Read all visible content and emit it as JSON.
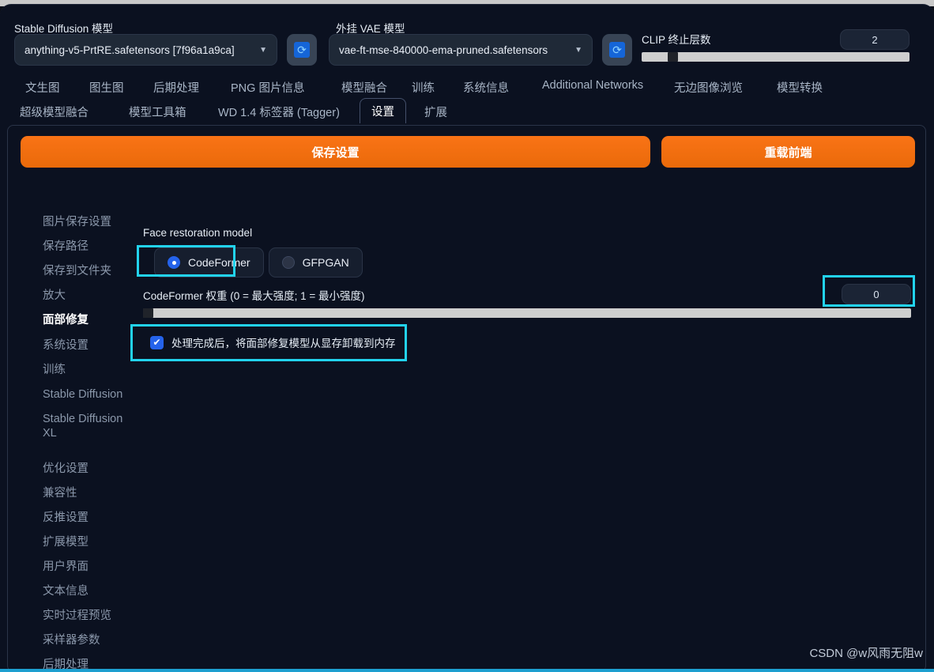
{
  "header": {
    "sd_model_label": "Stable Diffusion 模型",
    "sd_model_value": "anything-v5-PrtRE.safetensors [7f96a1a9ca]",
    "vae_label": "外挂 VAE 模型",
    "vae_value": "vae-ft-mse-840000-ema-pruned.safetensors",
    "clip_label": "CLIP 终止层数",
    "clip_value": "2",
    "refresh_icon": "refresh-icon",
    "caret_icon": "chevron-down-icon"
  },
  "tabs": {
    "row1": [
      {
        "label": "文生图",
        "active": false
      },
      {
        "label": "图生图",
        "active": false
      },
      {
        "label": "后期处理",
        "active": false
      },
      {
        "label": "PNG 图片信息",
        "active": false
      },
      {
        "label": "模型融合",
        "active": false
      },
      {
        "label": "训练",
        "active": false
      },
      {
        "label": "系统信息",
        "active": false
      },
      {
        "label": "Additional Networks",
        "active": false
      },
      {
        "label": "无边图像浏览",
        "active": false
      },
      {
        "label": "模型转换",
        "active": false
      }
    ],
    "row2": [
      {
        "label": "超级模型融合",
        "active": false
      },
      {
        "label": "模型工具箱",
        "active": false
      },
      {
        "label": "WD 1.4 标签器 (Tagger)",
        "active": false
      },
      {
        "label": "设置",
        "active": true
      },
      {
        "label": "扩展",
        "active": false
      }
    ]
  },
  "actions": {
    "save_label": "保存设置",
    "reload_label": "重载前端"
  },
  "sidebar": {
    "items": [
      {
        "label": "图片保存设置",
        "active": false
      },
      {
        "label": "保存路径",
        "active": false
      },
      {
        "label": "保存到文件夹",
        "active": false
      },
      {
        "label": "放大",
        "active": false
      },
      {
        "label": "面部修复",
        "active": true
      },
      {
        "label": "系统设置",
        "active": false
      },
      {
        "label": "训练",
        "active": false
      },
      {
        "label": "Stable Diffusion",
        "active": false
      },
      {
        "label": "Stable Diffusion XL",
        "active": false
      },
      {
        "label": "优化设置",
        "active": false
      },
      {
        "label": "兼容性",
        "active": false
      },
      {
        "label": "反推设置",
        "active": false
      },
      {
        "label": "扩展模型",
        "active": false
      },
      {
        "label": "用户界面",
        "active": false
      },
      {
        "label": "文本信息",
        "active": false
      },
      {
        "label": "实时过程预览",
        "active": false
      },
      {
        "label": "采样器参数",
        "active": false
      },
      {
        "label": "后期处理",
        "active": false
      }
    ]
  },
  "settings": {
    "face_restoration_model_label": "Face restoration model",
    "radios": [
      {
        "label": "CodeFormer",
        "checked": true
      },
      {
        "label": "GFPGAN",
        "checked": false
      }
    ],
    "codeformer_weight_label": "CodeFormer 权重 (0 = 最大强度; 1 = 最小强度)",
    "codeformer_weight_value": "0",
    "unload_checkbox_label": "处理完成后，将面部修复模型从显存卸载到内存",
    "unload_checkbox_checked": true
  },
  "watermark": "CSDN @w风雨无阻w",
  "colors": {
    "accent_orange": "#f97316",
    "highlight_cyan": "#22d3ee",
    "radio_blue": "#2563eb",
    "page_bg": "#0b1120"
  }
}
